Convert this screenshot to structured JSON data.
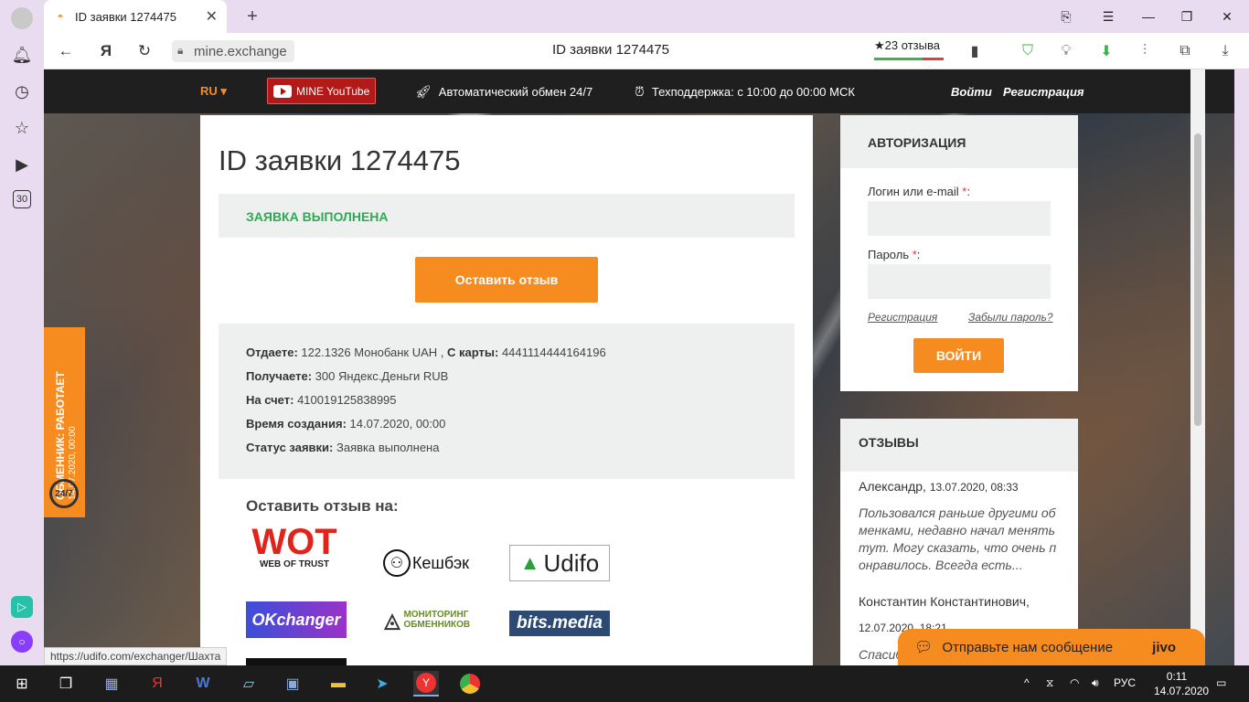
{
  "browser": {
    "tab_title": "ID заявки 1274475",
    "url": "mine.exchange",
    "page_title": "ID заявки 1274475",
    "reviews_badge": "★23 отзыва",
    "status_url": "https://udifo.com/exchanger/Шахта"
  },
  "site": {
    "lang": "RU ▾",
    "youtube_label": "MINE YouTube",
    "auto_exchange": "Автоматический обмен 24/7",
    "support": "Техподдержка: с 10:00 до 00:00 МСК",
    "login_link": "Войти",
    "register_link": "Регистрация"
  },
  "order": {
    "title": "ID заявки 1274475",
    "status_banner": "ЗАЯВКА ВЫПОЛНЕНА",
    "review_button": "Оставить отзыв",
    "give_label": "Отдаете:",
    "give_value": "122.1326 Монобанк UAH ,",
    "card_label": "С карты:",
    "card_value": "4441114444164196",
    "get_label": "Получаете:",
    "get_value": "300 Яндекс.Деньги RUB",
    "account_label": "На счет:",
    "account_value": "410019125838995",
    "created_label": "Время создания:",
    "created_value": "14.07.2020, 00:00",
    "status_label": "Статус заявки:",
    "status_value": "Заявка выполнена",
    "reviews_on": "Оставить отзыв на:"
  },
  "logos": {
    "wot": "WOT",
    "wot_sub": "WEB OF TRUST",
    "cashback": "Кешбэк",
    "udifo": "Udifo",
    "okchanger": "OKchanger",
    "monitoring": "МОНИТОРИНГ ОБМЕННИКОВ",
    "bits": "bits.media"
  },
  "auth": {
    "heading": "АВТОРИЗАЦИЯ",
    "login_label": "Логин или e-mail",
    "password_label": "Пароль",
    "req": "*",
    "colon": ":",
    "register": "Регистрация",
    "forgot": "Забыли пароль?",
    "submit": "ВОЙТИ"
  },
  "reviews": {
    "heading": "ОТЗЫВЫ",
    "r1_name": "Александр,",
    "r1_date": "13.07.2020, 08:33",
    "r1_text": "Пользовался раньше другими об менками, недавно начал менять тут. Могу сказать, что очень п онравилось. Всегда есть...",
    "r2_name": "Константин Константинович,",
    "r2_date": "12.07.2020, 18:21",
    "r2_text": "Спасиб"
  },
  "sidetab": {
    "status": "ОБМЕННИК: РАБОТАЕТ",
    "date": "14.07.2020, 00:00",
    "clock": "24/7"
  },
  "jivo": {
    "text": "Отправьте нам сообщение",
    "brand": "jivo"
  },
  "taskbar": {
    "lang": "РУС",
    "time": "0:11",
    "date": "14.07.2020"
  },
  "colors": {
    "accent": "#f68b1f",
    "success": "#2eaa52",
    "header": "#1f1f1f"
  }
}
